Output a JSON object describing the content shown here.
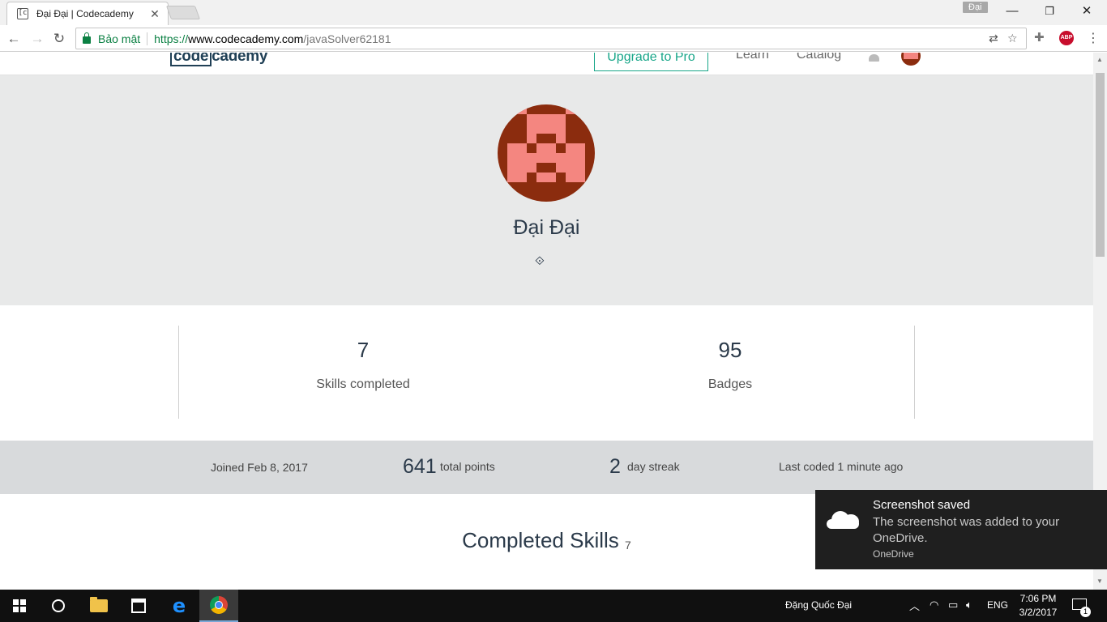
{
  "browser": {
    "tab_title": "Đại Đại | Codecademy",
    "favicon_text": "[c",
    "profile_name": "Đại",
    "secure_label": "Bảo mật",
    "url_protocol": "https://",
    "url_host": "www.codecademy.com",
    "url_path": "/javaSolver62181"
  },
  "site_nav": {
    "logo_bracket": "code",
    "logo_rest": "cademy",
    "upgrade_label": "Upgrade to Pro",
    "learn_label": "Learn",
    "catalog_label": "Catalog"
  },
  "profile": {
    "name": "Đại Đại",
    "skills_completed_value": "7",
    "skills_completed_label": "Skills completed",
    "badges_value": "95",
    "badges_label": "Badges",
    "joined": "Joined Feb 8, 2017",
    "total_points_value": "641",
    "total_points_label": "total points",
    "streak_value": "2",
    "streak_label": "day streak",
    "last_coded": "Last coded 1 minute ago",
    "completed_title": "Completed Skills",
    "completed_count": "7"
  },
  "colors": {
    "avatar_dark": "#8b2c0e",
    "avatar_light": "#f48680",
    "accent": "#18a689",
    "text_dark": "#2b3a4a"
  },
  "toast": {
    "title": "Screenshot saved",
    "body": "The screenshot was added to your OneDrive.",
    "source": "OneDrive",
    "icon": "onedrive-cloud-icon"
  },
  "taskbar": {
    "user_name": "Đặng Quốc Đại",
    "language": "ENG",
    "time": "7:06 PM",
    "date": "3/2/2017",
    "notification_count": "1"
  }
}
